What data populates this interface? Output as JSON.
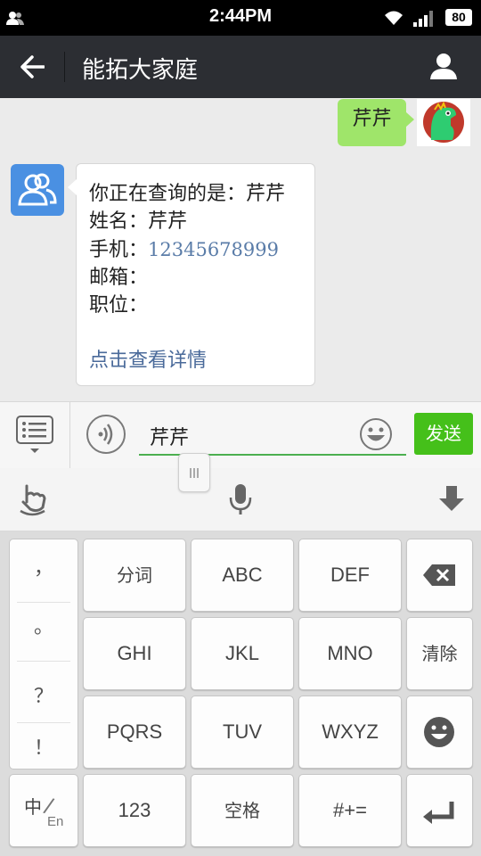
{
  "status_bar": {
    "time": "2:44PM",
    "battery": "80"
  },
  "header": {
    "title": "能拓大家庭"
  },
  "chat": {
    "outgoing": {
      "text": "芹芹"
    },
    "incoming": {
      "line1": "你正在查询的是：芹芹",
      "name_label": "姓名：",
      "name_value": "芹芹",
      "phone_label": "手机：",
      "phone_value": "12345678999",
      "email_label": "邮箱：",
      "position_label": "职位：",
      "link": "点击查看详情"
    }
  },
  "input_bar": {
    "text": "芹芹",
    "send_label": "发送"
  },
  "keyboard": {
    "punctuation": [
      "，",
      "。",
      "？",
      "！"
    ],
    "row1": [
      "分词",
      "ABC",
      "DEF"
    ],
    "row2": [
      "GHI",
      "JKL",
      "MNO",
      "清除"
    ],
    "row3": [
      "PQRS",
      "TUV",
      "WXYZ"
    ],
    "row4": [
      "123",
      "空格",
      "#+="
    ],
    "lang_switch_zh": "中",
    "lang_switch_en": "En"
  },
  "colors": {
    "send": "#45c01a",
    "bubble_out": "#9fe56a",
    "header": "#2c2e33"
  }
}
